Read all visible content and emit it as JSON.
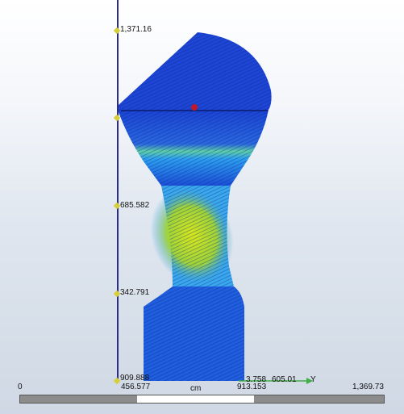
{
  "vertical_axis": {
    "ticks": [
      "1,371.16",
      "685.582",
      "342.791"
    ],
    "overlapped_zero_text": "909.888",
    "marker_color": "#d6cf3a",
    "line_color": "#2c2c8a"
  },
  "horizontal_axis": {
    "labels": [
      "3.758",
      "605.01"
    ],
    "axis_name": "Y",
    "axis_color": "#3cb043"
  },
  "scale_bar": {
    "unit": "cm",
    "labels": [
      "0",
      "456.577",
      "913.153",
      "1,369.73"
    ]
  },
  "model": {
    "description_colors": {
      "low": "#1a3ccc",
      "mid": "#2aa6ff",
      "high": "#d7e81b"
    },
    "marker_color": "#c01828"
  }
}
